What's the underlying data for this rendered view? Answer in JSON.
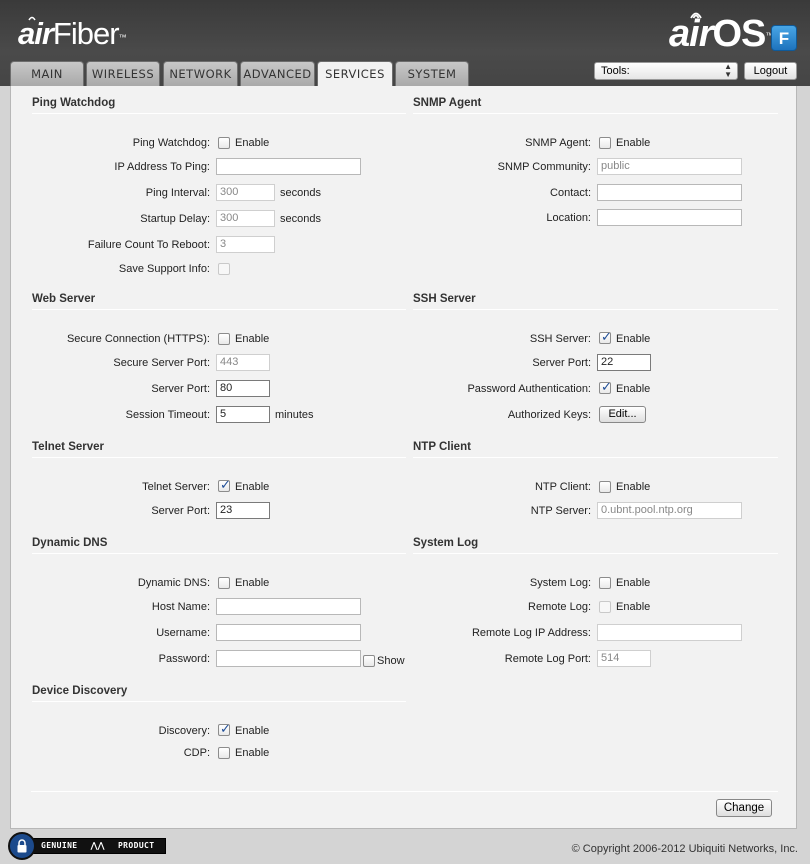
{
  "header": {
    "brand_air": "air",
    "brand_fiber": "Fiber",
    "brand_tm": "™",
    "os_air": "air",
    "os_os": "OS",
    "os_tm": "™",
    "os_badge": "F"
  },
  "tabs": [
    {
      "label": "MAIN"
    },
    {
      "label": "WIRELESS"
    },
    {
      "label": "NETWORK"
    },
    {
      "label": "ADVANCED"
    },
    {
      "label": "SERVICES",
      "active": true
    },
    {
      "label": "SYSTEM"
    }
  ],
  "tools": {
    "label": "Tools:"
  },
  "logout": {
    "label": "Logout"
  },
  "ping": {
    "title": "Ping Watchdog",
    "watchdog_label": "Ping Watchdog:",
    "enable": "Enable",
    "ip_label": "IP Address To Ping:",
    "ip_value": "",
    "interval_label": "Ping Interval:",
    "interval_value": "300",
    "interval_unit": "seconds",
    "startup_label": "Startup Delay:",
    "startup_value": "300",
    "startup_unit": "seconds",
    "failure_label": "Failure Count To Reboot:",
    "failure_value": "3",
    "support_label": "Save Support Info:"
  },
  "snmp": {
    "title": "SNMP Agent",
    "agent_label": "SNMP Agent:",
    "enable": "Enable",
    "community_label": "SNMP Community:",
    "community_value": "public",
    "contact_label": "Contact:",
    "contact_value": "",
    "location_label": "Location:",
    "location_value": ""
  },
  "web": {
    "title": "Web Server",
    "https_label": "Secure Connection (HTTPS):",
    "enable": "Enable",
    "secure_port_label": "Secure Server Port:",
    "secure_port_value": "443",
    "port_label": "Server Port:",
    "port_value": "80",
    "timeout_label": "Session Timeout:",
    "timeout_value": "5",
    "timeout_unit": "minutes"
  },
  "ssh": {
    "title": "SSH Server",
    "server_label": "SSH Server:",
    "enable": "Enable",
    "port_label": "Server Port:",
    "port_value": "22",
    "pwauth_label": "Password Authentication:",
    "pwauth_enable": "Enable",
    "keys_label": "Authorized Keys:",
    "edit_button": "Edit..."
  },
  "telnet": {
    "title": "Telnet Server",
    "server_label": "Telnet Server:",
    "enable": "Enable",
    "port_label": "Server Port:",
    "port_value": "23"
  },
  "ntp": {
    "title": "NTP Client",
    "client_label": "NTP Client:",
    "enable": "Enable",
    "server_label": "NTP Server:",
    "server_value": "0.ubnt.pool.ntp.org"
  },
  "ddns": {
    "title": "Dynamic DNS",
    "ddns_label": "Dynamic DNS:",
    "enable": "Enable",
    "host_label": "Host Name:",
    "host_value": "",
    "user_label": "Username:",
    "user_value": "",
    "pass_label": "Password:",
    "pass_value": "",
    "show_label": "Show"
  },
  "syslog": {
    "title": "System Log",
    "log_label": "System Log:",
    "enable": "Enable",
    "remote_label": "Remote Log:",
    "remote_enable": "Enable",
    "remote_ip_label": "Remote Log IP Address:",
    "remote_ip_value": "",
    "remote_port_label": "Remote Log Port:",
    "remote_port_value": "514"
  },
  "discovery": {
    "title": "Device Discovery",
    "discovery_label": "Discovery:",
    "enable": "Enable",
    "cdp_label": "CDP:",
    "cdp_enable": "Enable"
  },
  "actions": {
    "change_button": "Change"
  },
  "footer": {
    "genuine": "GENUINE",
    "product": "PRODUCT",
    "copyright": "© Copyright 2006-2012 Ubiquiti Networks, Inc."
  }
}
